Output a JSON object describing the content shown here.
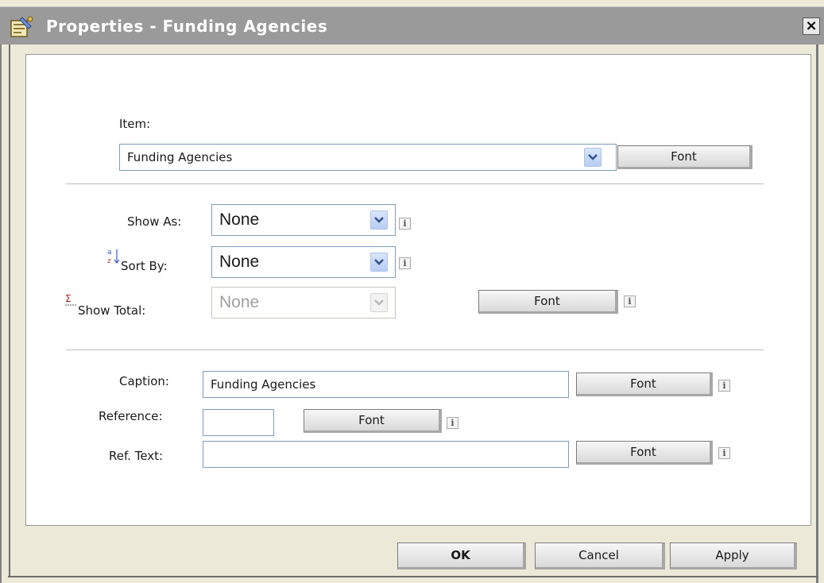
{
  "window": {
    "title": "Properties - Funding Agencies",
    "close_label": "×"
  },
  "item": {
    "label": "Item:",
    "value": "Funding Agencies",
    "font_label": "Font"
  },
  "display": {
    "show_as_label": "Show As:",
    "show_as_value": "None",
    "sort_by_label": "Sort By:",
    "sort_by_value": "None",
    "show_total_label": "Show Total:",
    "show_total_value": "None",
    "show_total_font_label": "Font",
    "info_glyph": "i"
  },
  "caption": {
    "caption_label": "Caption:",
    "caption_value": "Funding Agencies",
    "caption_font_label": "Font",
    "reference_label": "Reference:",
    "reference_value": "",
    "reference_font_label": "Font",
    "ref_text_label": "Ref. Text:",
    "ref_text_value": "",
    "ref_text_font_label": "Font"
  },
  "footer": {
    "ok_label": "OK",
    "cancel_label": "Cancel",
    "apply_label": "Apply"
  },
  "colors": {
    "titlebar": "#9a9a9a",
    "dialog_bg": "#ece9d8",
    "field_border": "#7f9db9"
  }
}
